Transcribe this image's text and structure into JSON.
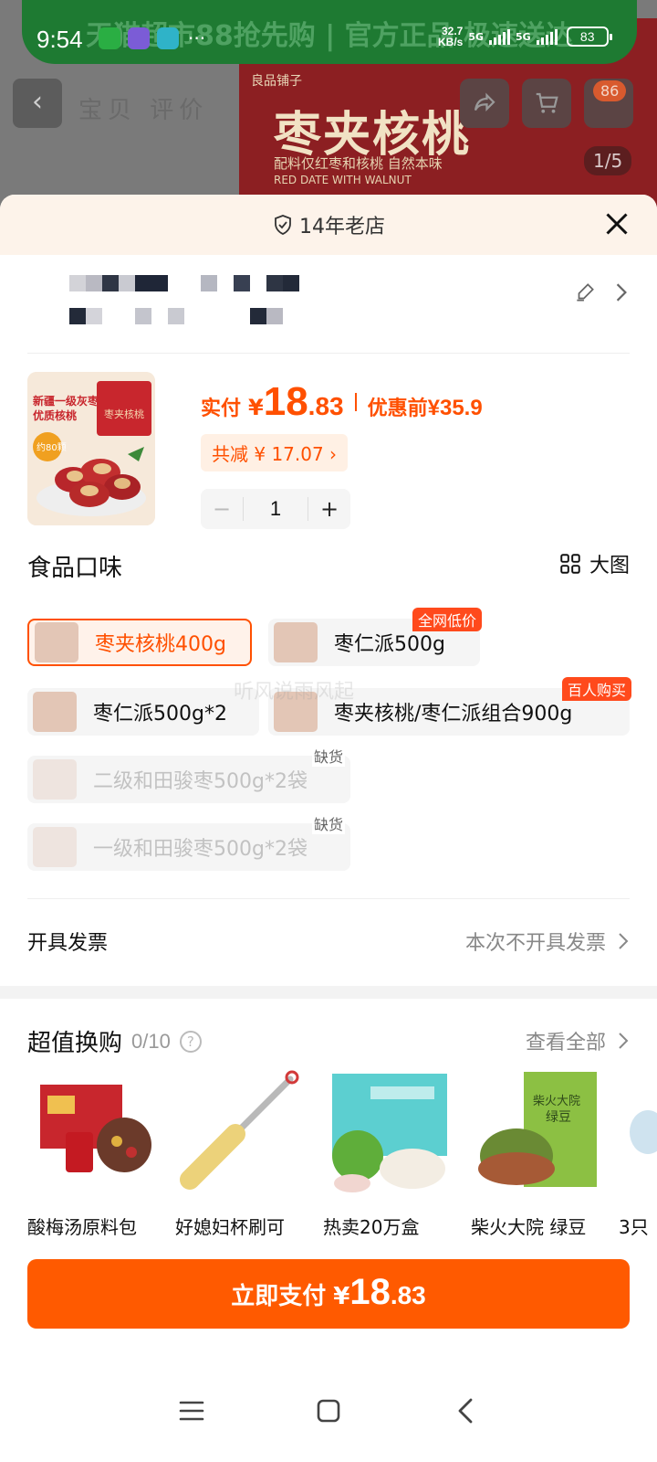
{
  "status_bar": {
    "time": "9:54",
    "banner": "天猫超市88抢先购 | 官方正品 极速送达",
    "net_speed_value": "32.7",
    "net_speed_unit": "KB/s",
    "network_1": "5G",
    "network_2": "5G",
    "battery": "83",
    "more": "···"
  },
  "background": {
    "tabs": "宝贝 评价",
    "product_brand": "良品铺子",
    "product_title": "枣夹核桃",
    "product_subtitle": "配料仅红枣和核桃 自然本味",
    "product_en": "RED DATE WITH WALNUT",
    "cart_badge": "86",
    "image_page": "1/5"
  },
  "sheet": {
    "shop_badge": "14年老店"
  },
  "product": {
    "image_caption_1": "新疆一级灰枣",
    "image_caption_2": "优质核桃",
    "image_badge": "约80颗",
    "image_pack": "枣夹核桃",
    "pay_label": "实付",
    "pay_currency": "¥",
    "pay_int": "18",
    "pay_dec": ".83",
    "original_label": "优惠前",
    "original_price": "¥35.9",
    "discount_text": "共减 ¥ 17.07 ›",
    "quantity": "1",
    "minus": "−",
    "plus": "+"
  },
  "variants": {
    "title": "食品口味",
    "big_view": "大图",
    "options": [
      {
        "label": "枣夹核桃400g",
        "state": "selected",
        "tag": ""
      },
      {
        "label": "枣仁派500g",
        "state": "normal",
        "tag": "全网低价"
      },
      {
        "label": "枣仁派500g*2",
        "state": "normal",
        "tag": ""
      },
      {
        "label": "枣夹核桃/枣仁派组合900g",
        "state": "normal",
        "tag": "百人购买"
      },
      {
        "label": "二级和田骏枣500g*2袋",
        "state": "disabled",
        "tag": "缺货"
      },
      {
        "label": "一级和田骏枣500g*2袋",
        "state": "disabled",
        "tag": "缺货"
      }
    ]
  },
  "watermark": "听风说雨风起",
  "invoice": {
    "label": "开具发票",
    "value": "本次不开具发票"
  },
  "deals": {
    "title": "超值换购",
    "count": "0/10",
    "help": "?",
    "see_all": "查看全部",
    "items": [
      {
        "name": "酸梅汤原料包"
      },
      {
        "name": "好媳妇杯刷可"
      },
      {
        "name": "热卖20万盒"
      },
      {
        "name": "柴火大院 绿豆"
      },
      {
        "name": "3只"
      }
    ],
    "item4_pack_text_1": "柴火大院",
    "item4_pack_text_2": "绿豆"
  },
  "pay_button": {
    "label": "立即支付",
    "currency": "¥",
    "int": "18",
    "dec": ".83"
  },
  "colors": {
    "accent": "#ff5000",
    "pay_button": "#ff5a00",
    "tag_red": "#ff4a1c",
    "header_bg": "#fdf3ea"
  },
  "icons": {
    "status_apps": [
      "wechat-icon",
      "app-icon",
      "shield-app-icon"
    ],
    "nav": [
      "menu-icon",
      "home-icon",
      "back-icon"
    ]
  }
}
